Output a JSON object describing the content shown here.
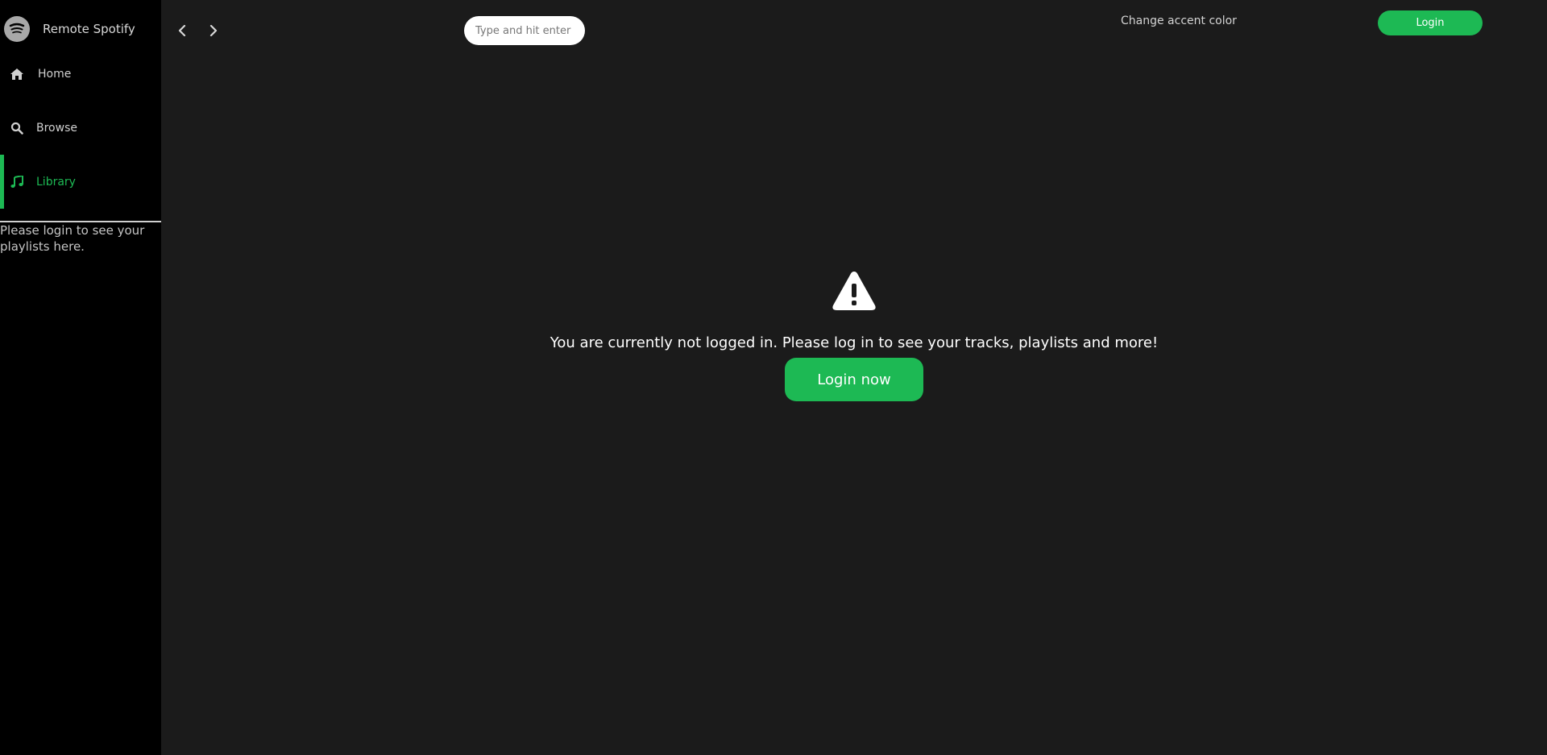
{
  "app": {
    "title": "Remote Spotify"
  },
  "sidebar": {
    "items": [
      {
        "label": "Home",
        "icon": "home-icon"
      },
      {
        "label": "Browse",
        "icon": "search-icon"
      },
      {
        "label": "Library",
        "icon": "music-note-icon",
        "active": true
      }
    ],
    "message": "Please login to see your playlists here."
  },
  "topbar": {
    "search_placeholder": "Type and hit enter to search",
    "accent_label": "Change accent color",
    "login_label": "Login"
  },
  "notice": {
    "icon": "warning-icon",
    "text": "You are currently not logged in. Please log in to see your tracks, playlists and more!",
    "button_label": "Login now"
  },
  "colors": {
    "accent": "#1db954",
    "sidebar_bg": "#000000",
    "main_bg": "#1b1b1b"
  }
}
